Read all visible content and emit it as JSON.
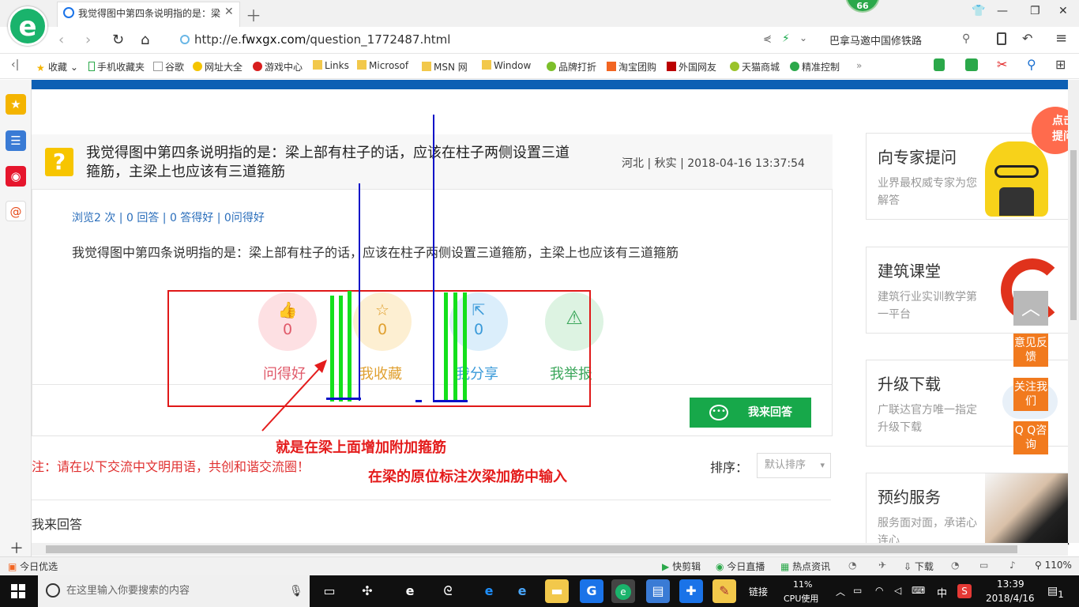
{
  "browser": {
    "tab_title": "我觉得图中第四条说明指的是：梁",
    "url_prefix": "http://e.",
    "url_domain": "fwxgx.com",
    "url_path": "/question_1772487.html",
    "search_text": "巴拿马邀中国修铁路",
    "badge": "66",
    "logo": "e"
  },
  "bookmarks": [
    "收藏",
    "手机收藏夹",
    "谷歌",
    "网址大全",
    "游戏中心",
    "Links",
    "Microsof",
    "MSN 网",
    "Window",
    "品牌打折",
    "淘宝团购",
    "外国网友",
    "天猫商城",
    "精准控制"
  ],
  "question": {
    "title": "我觉得图中第四条说明指的是：梁上部有柱子的话，应该在柱子两侧设置三道箍筋，主梁上也应该有三道箍筋",
    "meta": "河北 | 秋实 | 2018-04-16 13:37:54",
    "stats": "浏览2 次 | 0 回答 | 0 答得好 | 0问得好",
    "body": "我觉得图中第四条说明指的是：梁上部有柱子的话，应该在柱子两侧设置三道箍筋，主梁上也应该有三道箍筋"
  },
  "actions": [
    {
      "label": "问得好",
      "count": "0",
      "color": "#e05a6a",
      "bg": "#fde0e3"
    },
    {
      "label": "我收藏",
      "count": "0",
      "color": "#e0a030",
      "bg": "#fdefd2"
    },
    {
      "label": "我分享",
      "count": "0",
      "color": "#3a9ad9",
      "bg": "#dbeefb"
    },
    {
      "label": "我举报",
      "count": "",
      "color": "#3aa65a",
      "bg": "#ddf3e2"
    }
  ],
  "answer_button": "我来回答",
  "notice": "注：请在以下交流中文明用语，共创和谐交流圈！",
  "sort": {
    "label": "排序：",
    "value": "默认排序"
  },
  "my_answer": "我来回答",
  "annotations": {
    "note1": "就是在梁上面增加附加箍筋",
    "note2": "在梁的原位标注次梁加筋中输入"
  },
  "right_cards": [
    {
      "title": "向专家提问",
      "sub": "业界最权威专家为您解答"
    },
    {
      "title": "建筑课堂",
      "sub": "建筑行业实训教学第一平台"
    },
    {
      "title": "升级下载",
      "sub": "广联达官方唯一指定升级下载"
    },
    {
      "title": "预约服务",
      "sub": "服务面对面，承诺心连心"
    }
  ],
  "float_buttons": {
    "feedback": "意见反馈",
    "follow": "关注我们",
    "qq": "Q Q咨询",
    "click": "点击提问"
  },
  "statusbar": {
    "left": "今日优选",
    "items": [
      "快剪辑",
      "今日直播",
      "热点资讯",
      "下载"
    ],
    "zoom": "110%"
  },
  "taskbar": {
    "search_placeholder": "在这里输入你要搜索的内容",
    "link": "链接",
    "cpu_percent": "11%",
    "cpu_label": "CPU使用",
    "ime": "中",
    "time": "13:39",
    "date": "2018/4/16",
    "notify": "1"
  }
}
